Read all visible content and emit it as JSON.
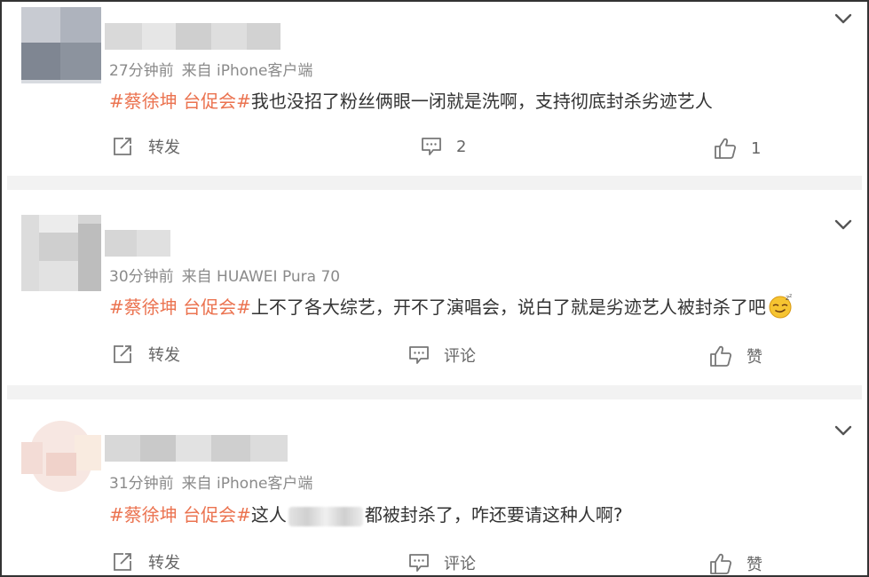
{
  "colors": {
    "tag": "#eb7350",
    "meta": "#8a8a8a",
    "divider": "#f2f2f2"
  },
  "comments": [
    {
      "meta_time": "27分钟前",
      "meta_source": "来自 iPhone客户端",
      "tag": "#蔡徐坤 台促会#",
      "text": "我也没招了粉丝俩眼一闭就是洗啊，支持彻底封杀劣迹艺人",
      "repost_label": "转发",
      "comment_label": "2",
      "like_label": "1",
      "icons": {
        "repost": "share-icon",
        "comment": "comment-icon",
        "like": "thumbs-up-icon",
        "menu": "chevron-down-icon"
      }
    },
    {
      "meta_time": "30分钟前",
      "meta_source": "来自 HUAWEI Pura 70",
      "tag": "#蔡徐坤 台促会#",
      "text": "上不了各大综艺，开不了演唱会，说白了就是劣迹艺人被封杀了吧",
      "repost_label": "转发",
      "comment_label": "评论",
      "like_label": "赞",
      "icons": {
        "repost": "share-icon",
        "comment": "comment-icon",
        "like": "thumbs-up-icon",
        "menu": "chevron-down-icon",
        "emoji": "smirk-emoji-icon"
      }
    },
    {
      "meta_time": "31分钟前",
      "meta_source": "来自 iPhone客户端",
      "tag": "#蔡徐坤 台促会#",
      "text_before": "这人",
      "text_after": "都被封杀了，咋还要请这种人啊?",
      "repost_label": "转发",
      "comment_label": "评论",
      "like_label": "赞",
      "icons": {
        "repost": "share-icon",
        "comment": "comment-icon",
        "like": "thumbs-up-icon",
        "menu": "chevron-down-icon"
      }
    }
  ]
}
